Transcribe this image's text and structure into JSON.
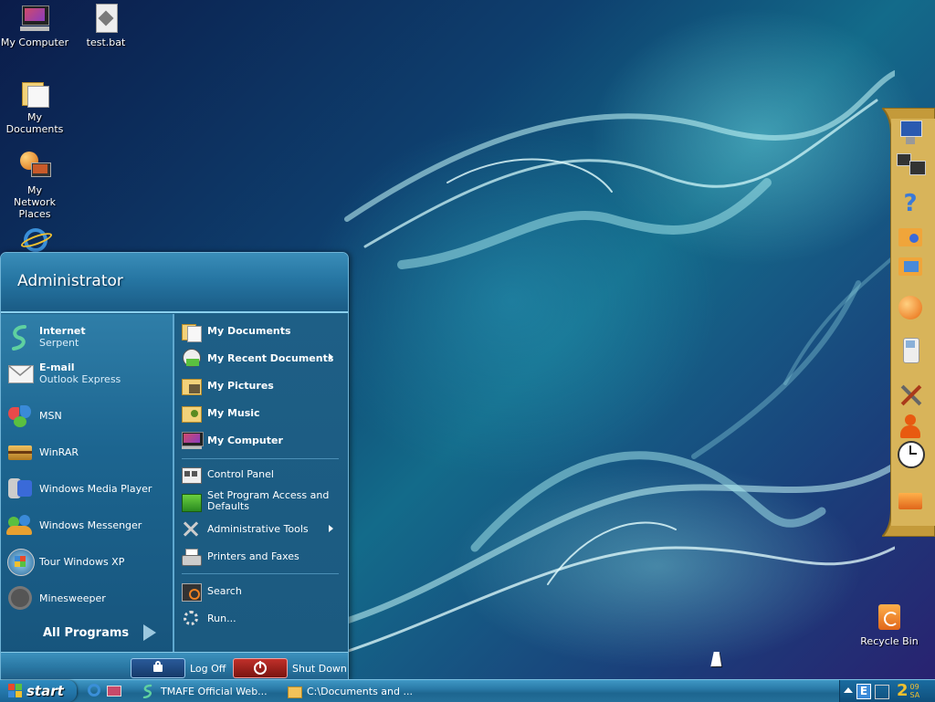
{
  "desktop": {
    "icons": [
      {
        "label": "My Computer"
      },
      {
        "label": "test.bat"
      },
      {
        "label": "My Documents"
      },
      {
        "label": "My Network Places"
      },
      {
        "label": "Recycle Bin"
      }
    ]
  },
  "start_menu": {
    "user": "Administrator",
    "pinned": [
      {
        "title": "Internet",
        "subtitle": "Serpent",
        "icon": "serpent-browser-icon"
      },
      {
        "title": "E-mail",
        "subtitle": "Outlook Express",
        "icon": "outlook-express-icon"
      }
    ],
    "recent": [
      {
        "label": "MSN",
        "icon": "msn-butterfly-icon"
      },
      {
        "label": "WinRAR",
        "icon": "winrar-icon"
      },
      {
        "label": "Windows Media Player",
        "icon": "media-player-icon"
      },
      {
        "label": "Windows Messenger",
        "icon": "messenger-icon"
      },
      {
        "label": "Tour Windows XP",
        "icon": "tour-xp-icon"
      },
      {
        "label": "Minesweeper",
        "icon": "minesweeper-icon"
      }
    ],
    "all_programs": "All Programs",
    "places": [
      {
        "label": "My Documents",
        "bold": true,
        "icon": "documents-folder-icon"
      },
      {
        "label": "My Recent Documents",
        "bold": true,
        "icon": "recent-documents-icon",
        "submenu": true
      },
      {
        "label": "My Pictures",
        "bold": true,
        "icon": "pictures-folder-icon"
      },
      {
        "label": "My Music",
        "bold": true,
        "icon": "music-folder-icon"
      },
      {
        "label": "My Computer",
        "bold": true,
        "icon": "computer-icon"
      }
    ],
    "system": [
      {
        "label": "Control Panel",
        "icon": "control-panel-icon"
      },
      {
        "label": "Set Program Access and Defaults",
        "icon": "program-access-icon"
      },
      {
        "label": "Administrative Tools",
        "icon": "admin-tools-icon",
        "submenu": true
      },
      {
        "label": "Printers and Faxes",
        "icon": "printer-icon"
      }
    ],
    "tools": [
      {
        "label": "Search",
        "icon": "search-icon"
      },
      {
        "label": "Run...",
        "icon": "run-icon"
      }
    ],
    "logoff": "Log Off",
    "shutdown": "Shut Down"
  },
  "taskbar": {
    "start": "start",
    "tasks": [
      {
        "label": "TMAFE Official Web...",
        "icon": "serpent-browser-icon"
      },
      {
        "label": "C:\\Documents and ...",
        "icon": "folder-icon"
      }
    ],
    "clock": "2",
    "clock_small_top": "09",
    "clock_small_bottom": "SA"
  },
  "colors": {
    "accent": "#2a7aa8",
    "start_menu_bg": "#1d5f86",
    "dock": "#c49a3a",
    "shutdown": "#b0201c"
  }
}
